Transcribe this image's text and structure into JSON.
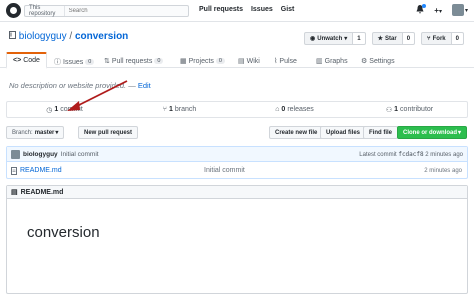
{
  "header": {
    "search_scope": "This repository",
    "search_placeholder": "Search",
    "nav": [
      "Pull requests",
      "Issues",
      "Gist"
    ],
    "plus_label": "+",
    "caret": "▾"
  },
  "repo": {
    "owner": "biologyguy",
    "separator": " / ",
    "name": "conversion",
    "actions": {
      "watch_label": "Unwatch",
      "watch_count": "1",
      "star_label": "Star",
      "star_count": "0",
      "fork_label": "Fork",
      "fork_count": "0"
    }
  },
  "tabs": {
    "code": "Code",
    "issues": "Issues",
    "issues_count": "0",
    "pulls": "Pull requests",
    "pulls_count": "0",
    "projects": "Projects",
    "projects_count": "0",
    "wiki": "Wiki",
    "pulse": "Pulse",
    "graphs": "Graphs",
    "settings": "Settings"
  },
  "description": {
    "text": "No description or website provided.",
    "dash": " — ",
    "edit": "Edit"
  },
  "summary": {
    "commits": "1",
    "commits_label": "commit",
    "branches": "1",
    "branches_label": "branch",
    "releases": "0",
    "releases_label": "releases",
    "contributors": "1",
    "contributors_label": "contributor"
  },
  "branch_row": {
    "branch_prefix": "Branch:",
    "branch_name": "master",
    "new_pr": "New pull request",
    "create_file": "Create new file",
    "upload_files": "Upload files",
    "find_file": "Find file",
    "clone": "Clone or download"
  },
  "latest_commit": {
    "author": "biologyguy",
    "message": "Initial commit",
    "latest_label": "Latest commit",
    "sha": "fcdacf8",
    "age": "2 minutes ago"
  },
  "files": [
    {
      "name": "README.md",
      "message": "Initial commit",
      "age": "2 minutes ago"
    }
  ],
  "readme": {
    "title": "README.md",
    "heading": "conversion"
  },
  "colors": {
    "accent": "#e36209",
    "link": "#0366d6",
    "clone_green": "#2cbe4e",
    "annotation_arrow": "#b01c1c"
  }
}
